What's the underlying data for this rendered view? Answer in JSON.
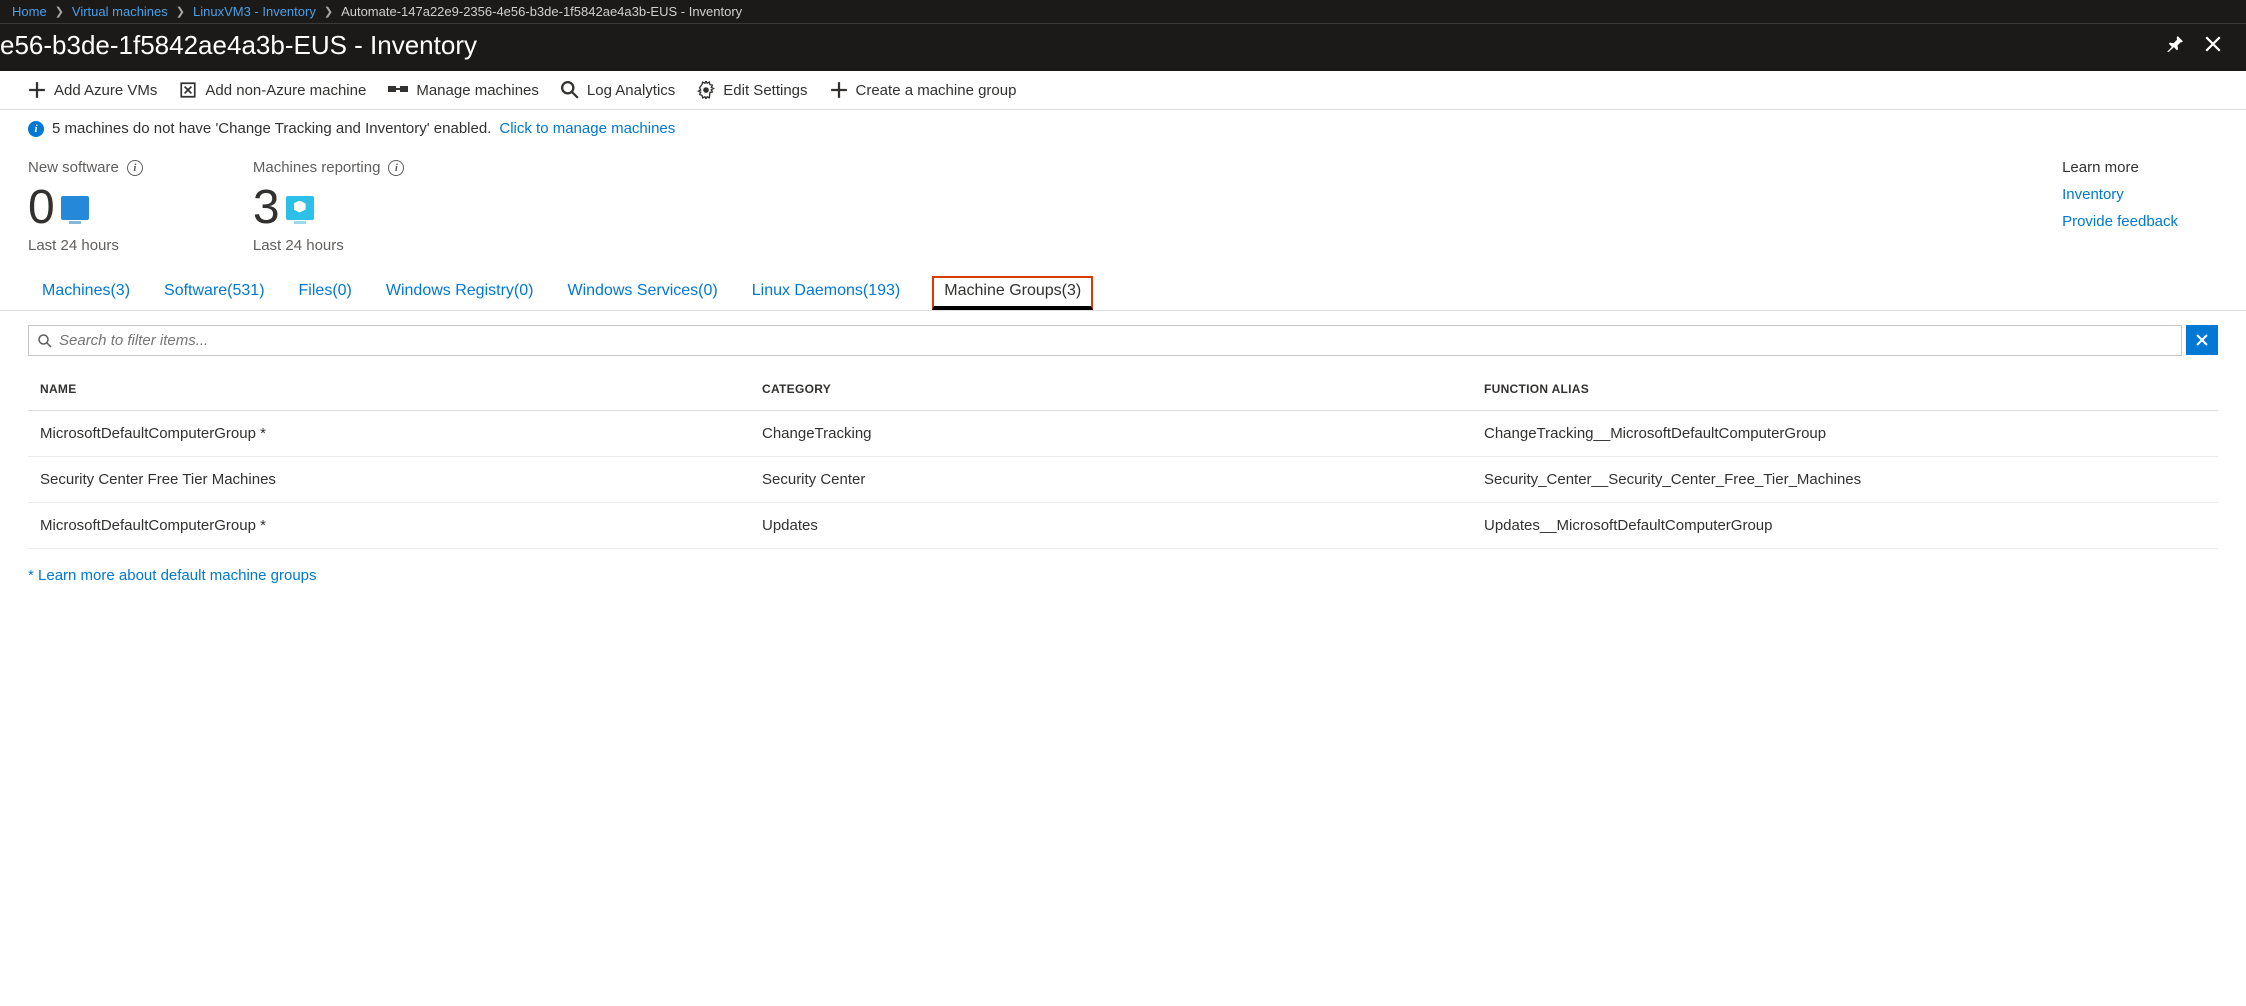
{
  "breadcrumb": {
    "items": [
      "Home",
      "Virtual machines",
      "LinuxVM3 - Inventory"
    ],
    "current": "Automate-147a22e9-2356-4e56-b3de-1f5842ae4a3b-EUS - Inventory"
  },
  "page_title": "e56-b3de-1f5842ae4a3b-EUS - Inventory",
  "toolbar": {
    "add_vms": "Add Azure VMs",
    "add_non_azure": "Add non-Azure machine",
    "manage": "Manage machines",
    "log_analytics": "Log Analytics",
    "edit_settings": "Edit Settings",
    "create_group": "Create a machine group"
  },
  "banner": {
    "text": "5 machines do not have 'Change Tracking and Inventory' enabled.",
    "link": "Click to manage machines"
  },
  "stats": {
    "new_software": {
      "label": "New software",
      "value": "0",
      "sub": "Last 24 hours"
    },
    "machines_reporting": {
      "label": "Machines reporting",
      "value": "3",
      "sub": "Last 24 hours"
    }
  },
  "learn_more": {
    "title": "Learn more",
    "inventory": "Inventory",
    "feedback": "Provide feedback"
  },
  "tabs": {
    "machines": "Machines(3)",
    "software": "Software(531)",
    "files": "Files(0)",
    "registry": "Windows Registry(0)",
    "services": "Windows Services(0)",
    "daemons": "Linux Daemons(193)",
    "groups": "Machine Groups(3)"
  },
  "search": {
    "placeholder": "Search to filter items..."
  },
  "table": {
    "headers": {
      "name": "NAME",
      "category": "CATEGORY",
      "alias": "FUNCTION ALIAS"
    },
    "rows": [
      {
        "name": "MicrosoftDefaultComputerGroup *",
        "category": "ChangeTracking",
        "alias": "ChangeTracking__MicrosoftDefaultComputerGroup"
      },
      {
        "name": "Security Center Free Tier Machines",
        "category": "Security Center",
        "alias": "Security_Center__Security_Center_Free_Tier_Machines"
      },
      {
        "name": "MicrosoftDefaultComputerGroup *",
        "category": "Updates",
        "alias": "Updates__MicrosoftDefaultComputerGroup"
      }
    ]
  },
  "footnote": "* Learn more about default machine groups"
}
